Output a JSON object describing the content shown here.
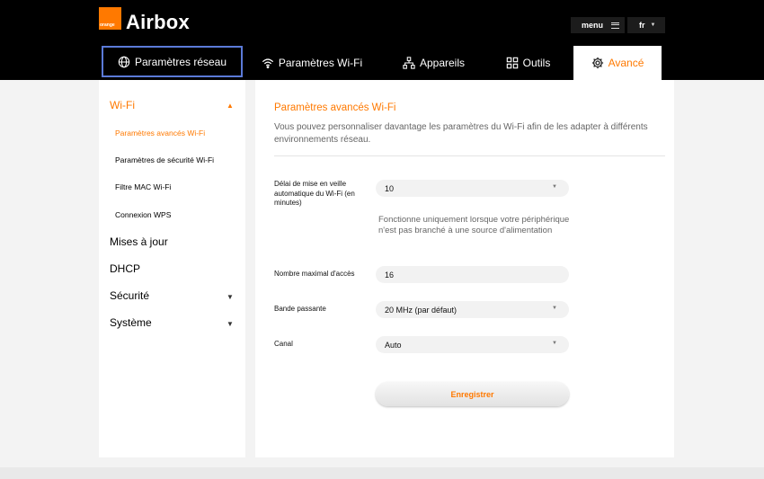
{
  "header": {
    "logo_text": "orange",
    "brand": "Airbox",
    "menu_label": "menu",
    "lang_label": "fr"
  },
  "nav": {
    "tabs": [
      {
        "label": "Paramètres réseau",
        "icon": "globe-icon"
      },
      {
        "label": "Paramètres Wi-Fi",
        "icon": "wifi-icon"
      },
      {
        "label": "Appareils",
        "icon": "devices-icon"
      },
      {
        "label": "Outils",
        "icon": "tools-icon"
      },
      {
        "label": "Avancé",
        "icon": "gear-icon"
      }
    ],
    "active": "Avancé",
    "focused": "Paramètres réseau"
  },
  "sidebar": {
    "sections": [
      {
        "label": "Wi-Fi",
        "expanded": true
      },
      {
        "label": "Mises à jour"
      },
      {
        "label": "DHCP"
      },
      {
        "label": "Sécurité",
        "expandable": true
      },
      {
        "label": "Système",
        "expandable": true
      }
    ],
    "wifi_items": [
      {
        "label": "Paramètres avancés Wi-Fi",
        "active": true
      },
      {
        "label": "Paramètres de sécurité Wi-Fi"
      },
      {
        "label": "Filtre MAC Wi-Fi"
      },
      {
        "label": "Connexion WPS"
      }
    ]
  },
  "main": {
    "title": "Paramètres avancés Wi-Fi",
    "description": "Vous pouvez personnaliser davantage les paramètres du Wi-Fi afin de les adapter à différents environnements réseau.",
    "fields": {
      "sleep_label": "Délai de mise en veille automatique du Wi-Fi (en minutes)",
      "sleep_value": "10",
      "sleep_hint": "Fonctionne uniquement lorsque votre périphérique n'est pas branché à une source d'alimentation",
      "max_access_label": "Nombre maximal d'accès",
      "max_access_value": "16",
      "bandwidth_label": "Bande passante",
      "bandwidth_value": "20 MHz (par défaut)",
      "channel_label": "Canal",
      "channel_value": "Auto"
    },
    "save_label": "Enregistrer"
  },
  "colors": {
    "accent": "#ff7900",
    "header_bg": "#000000",
    "focus_ring": "#5b7ad8"
  }
}
